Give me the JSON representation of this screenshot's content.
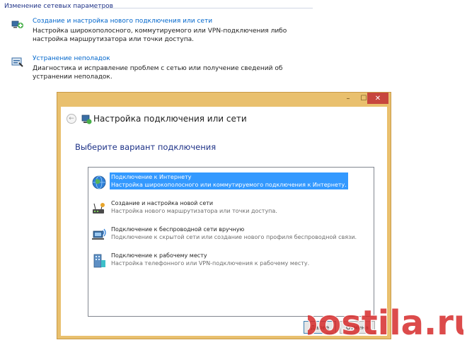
{
  "section": {
    "title": "Изменение сетевых параметров"
  },
  "tasks": [
    {
      "icon": "network-setup-icon",
      "link": "Создание и настройка нового подключения или сети",
      "description": "Настройка широкополосного, коммутируемого или VPN-подключения либо настройка маршрутизатора или точки доступа."
    },
    {
      "icon": "troubleshoot-icon",
      "link": "Устранение неполадок",
      "description": "Диагностика и исправление проблем с сетью или получение сведений об устранении неполадок."
    }
  ],
  "window": {
    "title": "Настройка подключения или сети",
    "controls": {
      "minimize": "–",
      "maximize": "☐",
      "close": "✕"
    },
    "back": "←",
    "subheading": "Выберите вариант подключения",
    "options": [
      {
        "icon": "internet-globe-icon",
        "title": "Подключение к Интернету",
        "description": "Настройка широкополосного или коммутируемого подключения к Интернету.",
        "selected": true
      },
      {
        "icon": "new-network-icon",
        "title": "Создание и настройка новой сети",
        "description": "Настройка нового маршрутизатора или точки доступа.",
        "selected": false
      },
      {
        "icon": "wireless-network-icon",
        "title": "Подключение к беспроводной сети вручную",
        "description": "Подключение к скрытой сети или создание нового профиля беспроводной связи.",
        "selected": false
      },
      {
        "icon": "workplace-icon",
        "title": "Подключение к рабочему месту",
        "description": "Настройка телефонного или VPN-подключения к рабочему месту.",
        "selected": false
      }
    ],
    "buttons": {
      "next": "Далее",
      "cancel": "Отмена"
    }
  },
  "watermark": {
    "text": "postila.ru"
  },
  "colors": {
    "link": "#0066cc",
    "heading": "#1e3287",
    "selection": "#3399ff",
    "window_frame": "#e9c06e",
    "close_button": "#c7463e",
    "watermark": "#d62c2c"
  }
}
